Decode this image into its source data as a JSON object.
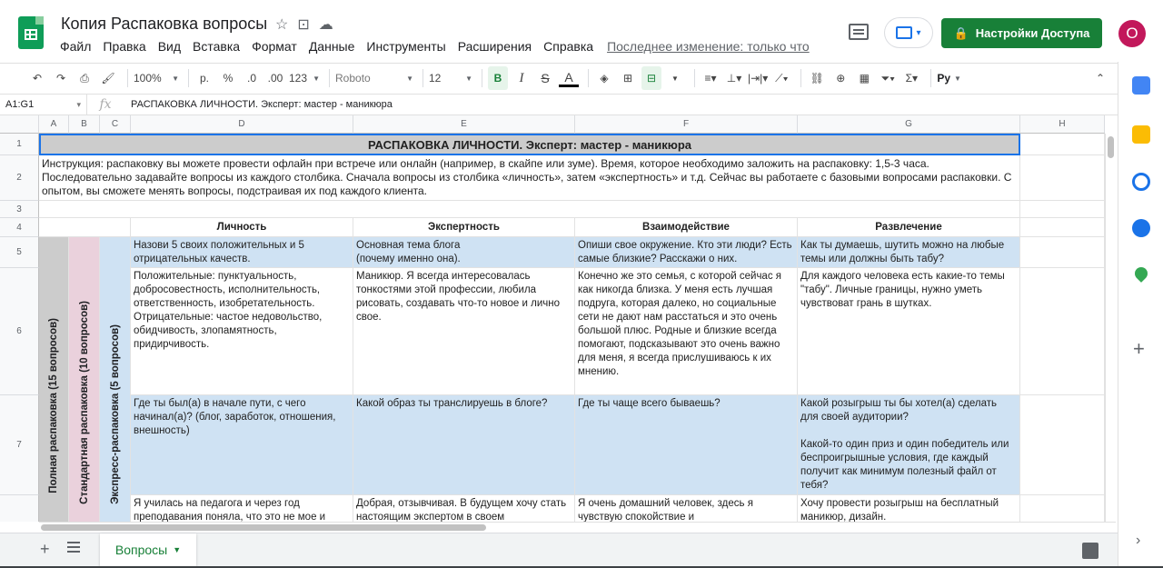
{
  "header": {
    "doc_title": "Копия Распаковка вопросы",
    "menu": [
      "Файл",
      "Правка",
      "Вид",
      "Вставка",
      "Формат",
      "Данные",
      "Инструменты",
      "Расширения",
      "Справка"
    ],
    "last_edit": "Последнее изменение: только что",
    "share_label": "Настройки Доступа",
    "avatar_letter": "О"
  },
  "toolbar": {
    "zoom": "100%",
    "currency": "р.",
    "percent": "%",
    "dec_less": ".0",
    "dec_more": ".00",
    "format_more": "123",
    "font": "Roboto",
    "font_size": "12",
    "bold": "B",
    "italic": "I",
    "strike": "S",
    "text_color": "A",
    "input_tools": "Ру"
  },
  "formula_bar": {
    "cell_ref": "A1:G1",
    "fx": "fx",
    "content": "РАСПАКОВКА ЛИЧНОСТИ. Эксперт: мастер - маникюра"
  },
  "columns": [
    "A",
    "B",
    "C",
    "D",
    "E",
    "F",
    "G",
    "H"
  ],
  "rows": [
    "1",
    "2",
    "3",
    "4",
    "5",
    "6",
    "7",
    ""
  ],
  "sheet": {
    "title": "РАСПАКОВКА ЛИЧНОСТИ. Эксперт: мастер - маникюра",
    "instruction": "Инструкция: распаковку вы можете провести офлайн при встрече или онлайн (например, в скайпе или зуме). Время, которое необходимо заложить на распаковку: 1,5-3 часа. Последовательно задавайте вопросы из каждого столбика. Сначала вопросы из столбика «личность», затем «экспертность» и т.д. Сейчас вы работаете с базовыми вопросами распаковки. С опытом, вы сможете менять вопросы, подстраивая их под каждого клиента.",
    "headers": [
      "Личность",
      "Экспертность",
      "Взаимодействие",
      "Развлечение"
    ],
    "vertical_labels": [
      "Полная распаковка (15 вопросов)",
      "Стандартная распаковка (10 вопросов)",
      "Экспресс-распаковка (5 вопросов)"
    ],
    "row5": [
      "Назови 5 своих положительных и 5 отрицательных качеств.",
      "Основная тема блога\n(почему именно она).",
      "Опиши свое окружение. Кто эти люди? Есть самые близкие? Расскажи о них.",
      "Как ты думаешь, шутить можно на любые темы или должны быть табу?"
    ],
    "row6": [
      "Положительные: пунктуальность, добросовестность, исполнительность, ответственность, изобретательность. Отрицательные: частое недовольство, обидчивость, злопамятность, придирчивость.",
      "Маникюр. Я всегда интересовалась тонкостями этой профессии, любила рисовать, создавать  что-то новое и лично свое.",
      "Конечно же это семья, с которой сейчас я как никогда близка. У меня есть лучшая подруга, которая далеко, но социальные сети не дают нам расстаться и это очень большой плюс. Родные и близкие всегда помогают, подсказывают это очень важно для меня, я всегда прислушиваюсь  к их мнению.",
      "Для каждого человека есть какие-то темы \"табу\". Личные границы, нужно уметь чувствоват грань в шутках."
    ],
    "row7": [
      "Где ты был(а) в начале пути, с чего начинал(а)? (блог, заработок, отношения, внешность)",
      "Какой образ ты транслируешь в блоге?",
      "Где ты чаще всего бываешь?",
      "Какой розыгрыш ты бы хотел(а) сделать для своей аудитории?\n\nКакой-то один приз и один победитель или беспроигрышные условия, где каждый получит как минимум полезный файл от тебя?"
    ],
    "row8": [
      "Я училась на педагога и через год преподавания поняла, что это не мое и",
      "Добрая, отзывчивая. В будущем хочу стать настоящим экспертом в своем",
      "Я очень домашний человек, здесь я чувствую спокойствие и",
      "Хочу провести розыгрыш на бесплатный маникюр, дизайн."
    ]
  },
  "tabs": {
    "sheet_name": "Вопросы"
  },
  "colors": {
    "accent_green": "#188038",
    "header_blue": "#cfe2f3",
    "title_gray": "#cccccc",
    "label_pink": "#ead1dc"
  }
}
